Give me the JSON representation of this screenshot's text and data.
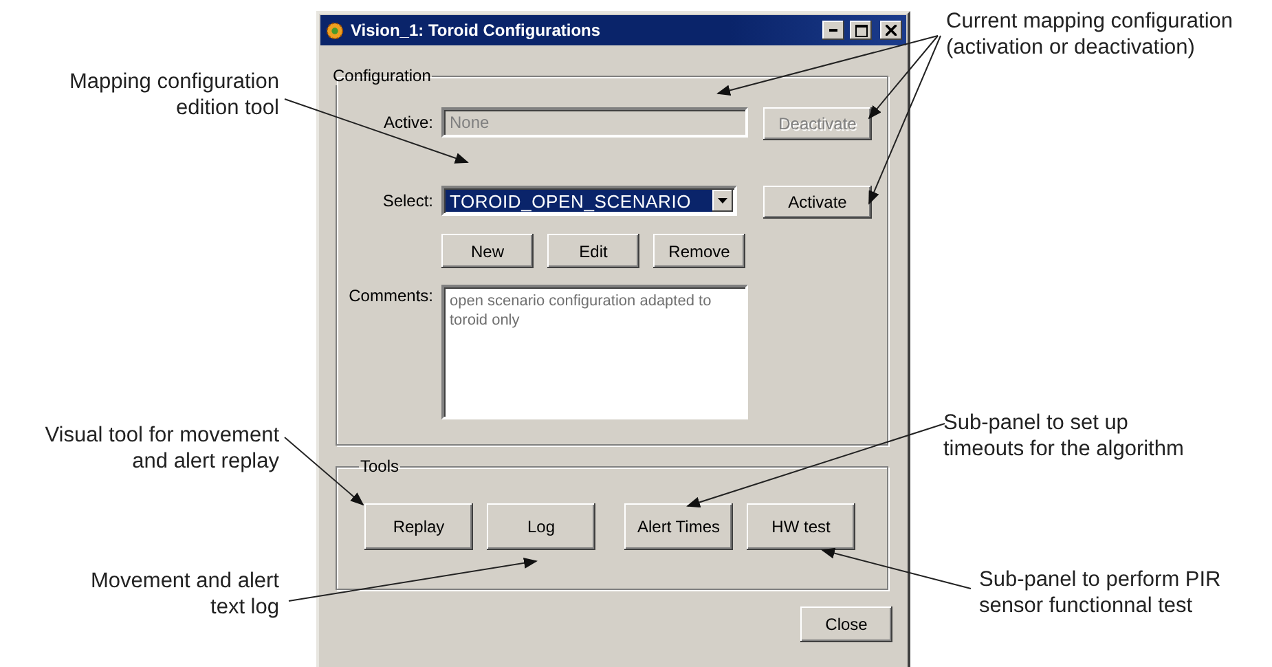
{
  "window": {
    "title": "Vision_1: Toroid Configurations"
  },
  "configuration": {
    "legend": "Configuration",
    "active": {
      "label": "Active:",
      "value": "None",
      "disabled": true
    },
    "deactivate": {
      "label": "Deactivate",
      "disabled": true
    },
    "select": {
      "label": "Select:",
      "value": "TOROID_OPEN_SCENARIO",
      "focused": true
    },
    "activate": {
      "label": "Activate",
      "disabled": false
    },
    "edit_buttons": [
      "New",
      "Edit",
      "Remove"
    ],
    "comments": {
      "label": "Comments:",
      "value": "open scenario configuration adapted to toroid only"
    }
  },
  "tools": {
    "legend": "Tools",
    "buttons": [
      "Replay",
      "Log",
      "Alert Times",
      "HW test"
    ]
  },
  "close_button": "Close",
  "annotations": [
    {
      "text": "Current mapping configuration\n(activation or deactivation)"
    },
    {
      "text": "Mapping configuration\nedition tool"
    },
    {
      "text": "Visual tool for movement\nand alert replay"
    },
    {
      "text": "Sub-panel to set up\ntimeouts for the algorithm"
    },
    {
      "text": "Movement and alert\ntext log"
    },
    {
      "text": "Sub-panel to perform PIR\nsensor functionnal test"
    }
  ]
}
